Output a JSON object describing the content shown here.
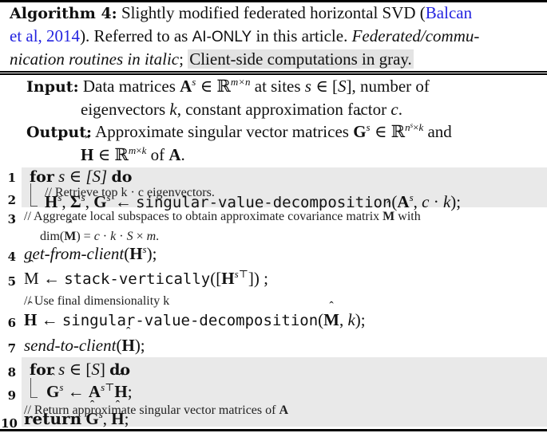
{
  "caption": {
    "label": "Algorithm 4:",
    "line1_text": "Slightly modified federated horizontal SVD (",
    "citation_part1": "Balcan",
    "citation_part2": "et al, 2014",
    "line2_after_cite": "). Referred to as ",
    "method_name": "AI-ONLY",
    "line2_rest": " in this article. ",
    "italic_note_part1": "Federated/commu-",
    "italic_note_part2": "nication routines in italic",
    "semicolon": "; ",
    "gray_note": "Client-side computations in gray."
  },
  "input": {
    "label": "Input:",
    "line1": "Data matrices Aˢ ∈ ℝᵐˣⁿ at sites s ∈ [S], number of",
    "line2": "eigenvectors k, constant approximation factor c."
  },
  "output": {
    "label": "Output:",
    "line1_text": "Approximate singular vector matrices ",
    "line1_math": "Ĝˢ ∈ ℝ^(nˢ×k)",
    "line1_end": " and",
    "line2_math": "Ĥ ∈ ℝ^(m×k)",
    "line2_end": " of A."
  },
  "steps": [
    {
      "num": "1",
      "keyword_for": "for",
      "expr": "s ∈ [S]",
      "keyword_do": "do",
      "client_side": true
    },
    {
      "num": "",
      "comment": "// Retrieve top k · c eigenvectors.",
      "client_side": true
    },
    {
      "num": "2",
      "lhs": "Hˢ, Σˢ, Gˢ ← ",
      "fn": "singular-value-decomposition",
      "args": "(Aˢ, c · k);",
      "client_side": true
    },
    {
      "num": "3",
      "comment": "// Aggregate local subspaces to obtain approximate covariance matrix M̂ with",
      "comment_cont": "dim(M̂) = c · k · S × m."
    },
    {
      "num": "4",
      "fn_italic": "get-from-client",
      "args": "(Hˢ);"
    },
    {
      "num": "5",
      "lhs": "M̂ ← ",
      "fn": "stack-vertically",
      "args": "([Hˢᵀ]) ;"
    },
    {
      "num": "",
      "comment": "// Use final dimensionality k"
    },
    {
      "num": "6",
      "lhs": "Ĥ ← ",
      "fn": "singular-value-decomposition",
      "args": "(M̂, k);"
    },
    {
      "num": "7",
      "fn_italic": "send-to-client",
      "args": "(Ĥ);"
    },
    {
      "num": "8",
      "keyword_for": "for",
      "expr": "s ∈ [S]",
      "keyword_do": "do",
      "client_side": true
    },
    {
      "num": "9",
      "expr": "Ĝˢ ← AˢᵀĤ;",
      "client_side": true
    },
    {
      "num": "",
      "comment": "// Return approximate singular vector matrices of A",
      "client_side": true
    },
    {
      "num": "10",
      "keyword": "return",
      "expr": "Ĝˢ, Ĥ;",
      "client_side": true
    }
  ],
  "colors": {
    "client_side_bg": "#e9e9e9",
    "citation_link": "#2323e0"
  }
}
